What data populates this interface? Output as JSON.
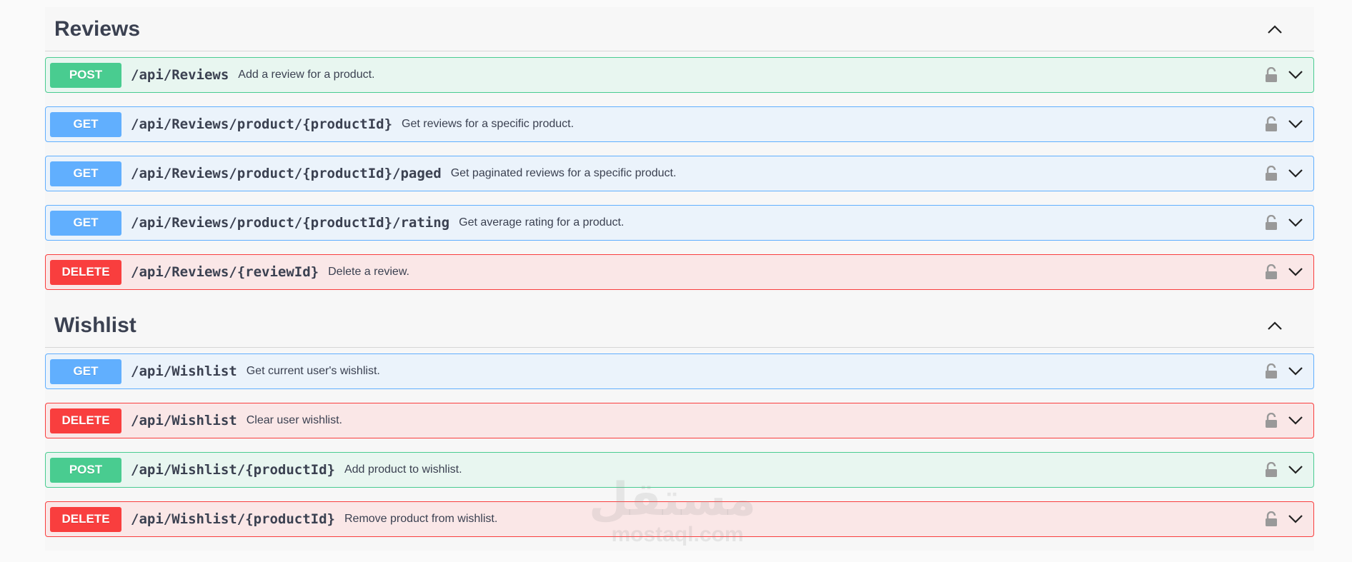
{
  "sections": [
    {
      "title": "Reviews",
      "operations": [
        {
          "method": "POST",
          "path": "/api/Reviews",
          "summary": "Add a review for a product."
        },
        {
          "method": "GET",
          "path": "/api/Reviews/product/{productId}",
          "summary": "Get reviews for a specific product."
        },
        {
          "method": "GET",
          "path": "/api/Reviews/product/{productId}/paged",
          "summary": "Get paginated reviews for a specific product."
        },
        {
          "method": "GET",
          "path": "/api/Reviews/product/{productId}/rating",
          "summary": "Get average rating for a product."
        },
        {
          "method": "DELETE",
          "path": "/api/Reviews/{reviewId}",
          "summary": "Delete a review."
        }
      ]
    },
    {
      "title": "Wishlist",
      "operations": [
        {
          "method": "GET",
          "path": "/api/Wishlist",
          "summary": "Get current user's wishlist."
        },
        {
          "method": "DELETE",
          "path": "/api/Wishlist",
          "summary": "Clear user wishlist."
        },
        {
          "method": "POST",
          "path": "/api/Wishlist/{productId}",
          "summary": "Add product to wishlist."
        },
        {
          "method": "DELETE",
          "path": "/api/Wishlist/{productId}",
          "summary": "Remove product from wishlist."
        }
      ]
    }
  ],
  "watermark": {
    "arabic": "مستقل",
    "latin": "mostaql.com"
  },
  "colors": {
    "post": "#49cc90",
    "get": "#61affe",
    "delete": "#f93e3e",
    "text": "#3b4151"
  },
  "icons": {
    "section_toggle": "chevron-up-icon",
    "auth": "lock-icon",
    "expand": "chevron-down-icon"
  }
}
